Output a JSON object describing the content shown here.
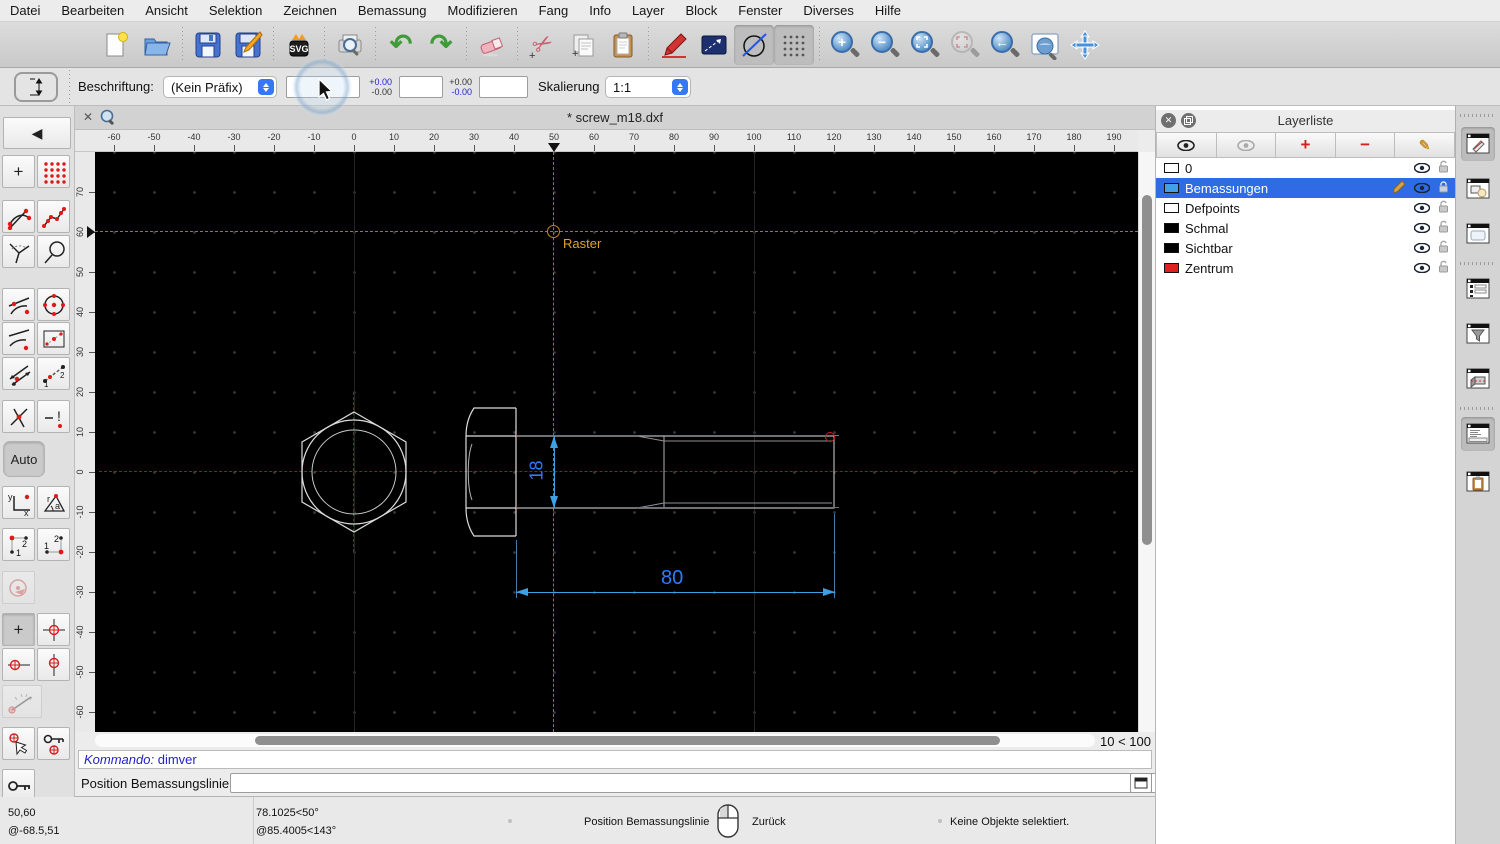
{
  "menu_bar": {
    "items": [
      "Datei",
      "Bearbeiten",
      "Ansicht",
      "Selektion",
      "Zeichnen",
      "Bemassung",
      "Modifizieren",
      "Fang",
      "Info",
      "Layer",
      "Block",
      "Fenster",
      "Diverses",
      "Hilfe"
    ]
  },
  "toolbar": {
    "buttons": [
      "new-file",
      "open-file",
      "save",
      "save-as",
      "svg-export",
      "print-preview",
      "undo",
      "redo",
      "delete",
      "cut",
      "copy",
      "paste",
      "draw-pencil",
      "selection-tool",
      "draft-mode",
      "grid-toggle",
      "zoom-in",
      "zoom-out",
      "zoom-auto",
      "zoom-selection",
      "zoom-previous",
      "zoom-window",
      "zoom-pan"
    ]
  },
  "options_bar": {
    "label": "Beschriftung:",
    "prefix_value": "(Kein Präfix)",
    "prefix_input": "",
    "tolerance_upper_1": "+0.00",
    "tolerance_lower_1": "-0.00",
    "tolerance_input_1": "",
    "tolerance_upper_2": "+0.00",
    "tolerance_lower_2": "-0.00",
    "tolerance_input_2": "",
    "scale_label": "Skalierung",
    "scale_value": "1:1"
  },
  "left_toolbar": {
    "auto_label": "Auto"
  },
  "canvas": {
    "tab_title": "* screw_m18.dxf",
    "h_ruler_ticks": [
      "-60",
      "-50",
      "-40",
      "-30",
      "-20",
      "-10",
      "0",
      "10",
      "20",
      "30",
      "40",
      "50",
      "60",
      "70",
      "80",
      "90",
      "100",
      "110",
      "120",
      "130",
      "140",
      "150",
      "160",
      "170",
      "180",
      "190"
    ],
    "v_ruler_ticks": [
      "70",
      "60",
      "50",
      "40",
      "30",
      "20",
      "10",
      "0",
      "-10",
      "-20",
      "-30",
      "-40",
      "-50",
      "-60"
    ],
    "raster_label": "Raster",
    "dim_diameter": "18",
    "dim_length": "80",
    "grid_status": "10 < 100",
    "colors": {
      "dimension_text": "#2d7dff",
      "dimension_line": "#3da0e3",
      "raster": "#c08a1e",
      "centerline": "#8f2020",
      "background": "#000000"
    }
  },
  "command_area": {
    "history_prefix": "Kommando:",
    "history_command": "dimver",
    "prompt_label": "Position Bemassungslinie:",
    "prompt_input": ""
  },
  "status_bar": {
    "abs_coord": "50,60",
    "rel_coord": "@-68.5,51",
    "abs_polar": "78.1025<50°",
    "rel_polar": "@85.4005<143°",
    "left_click_action": "Position Bemassungslinie",
    "right_click_action": "Zurück",
    "selection_status": "Keine Objekte selektiert."
  },
  "layer_panel": {
    "title": "Layerliste",
    "selection_color": "#2e6be5",
    "layers": [
      {
        "name": "0",
        "color": "#ffffff",
        "visible": true,
        "locked": false,
        "selected": false
      },
      {
        "name": "Bemassungen",
        "color": "#42a0e8",
        "visible": true,
        "locked": true,
        "selected": true
      },
      {
        "name": "Defpoints",
        "color": "#ffffff",
        "visible": true,
        "locked": false,
        "selected": false
      },
      {
        "name": "Schmal",
        "color": "#000000",
        "visible": true,
        "locked": false,
        "selected": false
      },
      {
        "name": "Sichtbar",
        "color": "#000000",
        "visible": true,
        "locked": false,
        "selected": false
      },
      {
        "name": "Zentrum",
        "color": "#e02020",
        "visible": true,
        "locked": false,
        "selected": false
      }
    ]
  },
  "right_dock": {
    "buttons": [
      "layer-list",
      "block-list",
      "library-browser",
      "entity-list",
      "selection-filter",
      "section-view",
      "command-line",
      "clipboard"
    ]
  }
}
